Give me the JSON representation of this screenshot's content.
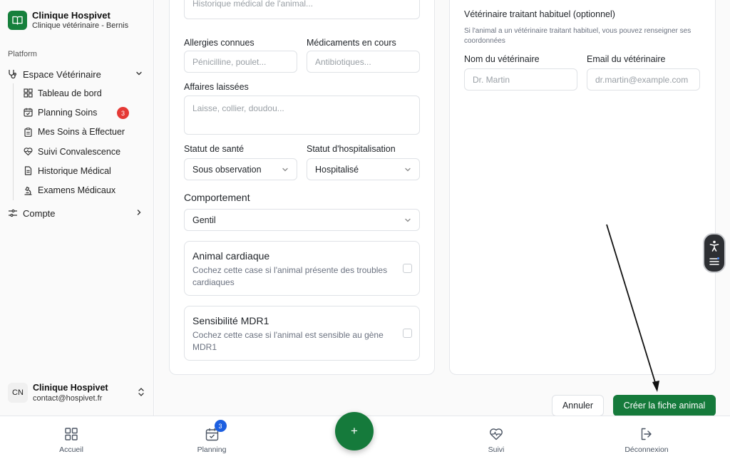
{
  "brand": {
    "title": "Clinique Hospivet",
    "subtitle": "Clinique vétérinaire - Bernis"
  },
  "sidebar": {
    "section_label": "Platform",
    "group": {
      "label": "Espace Vétérinaire",
      "icon": "stethoscope-icon"
    },
    "items": [
      {
        "label": "Tableau de bord",
        "icon": "dashboard-icon"
      },
      {
        "label": "Planning Soins",
        "icon": "calendar-check-icon",
        "badge": "3"
      },
      {
        "label": "Mes Soins à Effectuer",
        "icon": "clipboard-icon"
      },
      {
        "label": "Suivi Convalescence",
        "icon": "heart-pulse-icon"
      },
      {
        "label": "Historique Médical",
        "icon": "file-text-icon"
      },
      {
        "label": "Examens Médicaux",
        "icon": "microscope-icon"
      }
    ],
    "account": {
      "label": "Compte",
      "icon": "settings-sliders-icon"
    },
    "user": {
      "initials": "CN",
      "name": "Clinique Hospivet",
      "email": "contact@hospivet.fr"
    }
  },
  "form": {
    "history_placeholder": "Historique médical de l'animal...",
    "allergies": {
      "label": "Allergies connues",
      "placeholder": "Pénicilline, poulet..."
    },
    "medications": {
      "label": "Médicaments en cours",
      "placeholder": "Antibiotiques..."
    },
    "belongings": {
      "label": "Affaires laissées",
      "placeholder": "Laisse, collier, doudou..."
    },
    "health_status": {
      "label": "Statut de santé",
      "value": "Sous observation"
    },
    "hospital_status": {
      "label": "Statut d'hospitalisation",
      "value": "Hospitalisé"
    },
    "behavior": {
      "label": "Comportement",
      "value": "Gentil"
    },
    "cardiac": {
      "title": "Animal cardiaque",
      "desc": "Cochez cette case si l'animal présente des troubles cardiaques"
    },
    "mdr1": {
      "title": "Sensibilité MDR1",
      "desc": "Cochez cette case si l'animal est sensible au gène MDR1"
    }
  },
  "vet": {
    "title": "Vétérinaire traitant habituel (optionnel)",
    "desc": "Si l'animal a un vétérinaire traitant habituel, vous pouvez renseigner ses coordonnées",
    "name": {
      "label": "Nom du vétérinaire",
      "placeholder": "Dr. Martin"
    },
    "email": {
      "label": "Email du vétérinaire",
      "placeholder": "dr.martin@example.com"
    }
  },
  "actions": {
    "cancel": "Annuler",
    "create": "Créer la fiche animal"
  },
  "bottom_nav": {
    "home": "Accueil",
    "planning": "Planning",
    "planning_badge": "3",
    "add": "+",
    "follow": "Suivi",
    "logout": "Déconnexion"
  },
  "colors": {
    "primary": "#157a3b",
    "badge_red": "#e53935",
    "badge_blue": "#1d5fe0"
  }
}
